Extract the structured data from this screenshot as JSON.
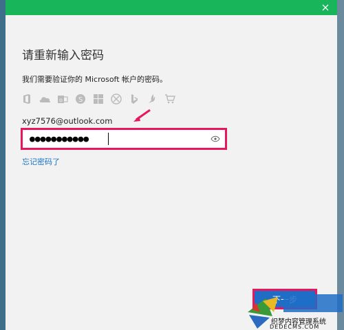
{
  "dialog": {
    "title": "请重新输入密码",
    "description": "我们需要验证你的 Microsoft 帐户的密码。",
    "email": "xyz7576@outlook.com",
    "password_mask": "●●●●●●●●●●●",
    "forgot_link": "忘记密码了",
    "next_label": "下一步"
  },
  "service_icons": [
    "office-icon",
    "onedrive-icon",
    "outlook-icon",
    "skype-icon",
    "windows-icon",
    "xbox-icon",
    "bing-icon",
    "msn-icon",
    "store-icon"
  ],
  "colors": {
    "titlebar": "#19b55a",
    "highlight": "#e8175d",
    "link": "#1a73c7",
    "button": "#1f6dc5"
  },
  "watermark": {
    "text": "织梦内容管理系统",
    "domain": "DEDECMS.COM"
  }
}
